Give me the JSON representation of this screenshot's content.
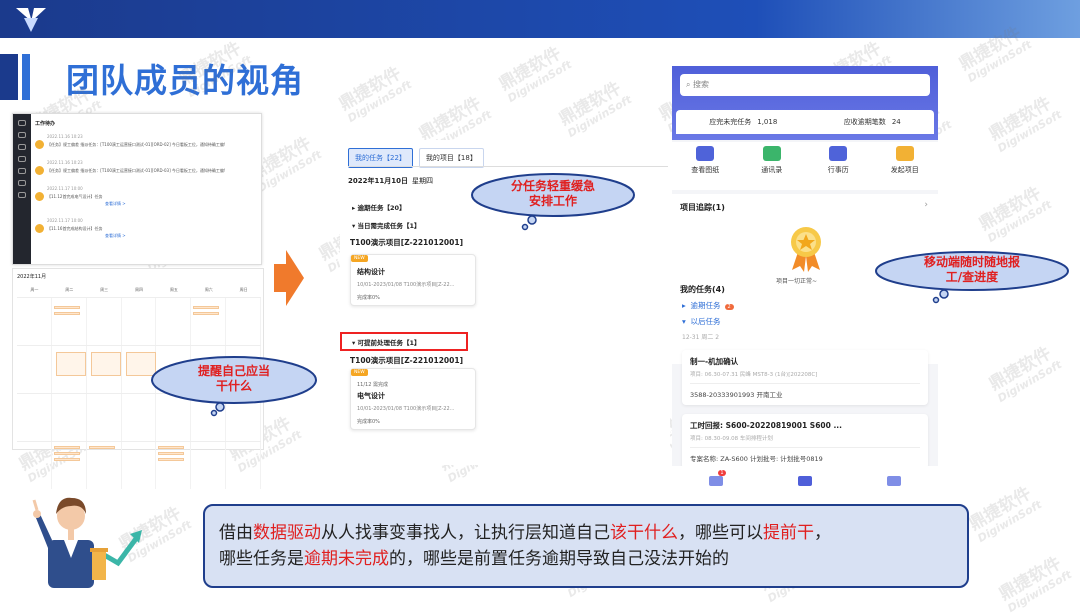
{
  "slide": {
    "title": "团队成员的视角",
    "summary": [
      {
        "text": "借由",
        "hl": false
      },
      {
        "text": "数据驱动",
        "hl": true
      },
      {
        "text": "从人找事变事找人，让执行层知道自己",
        "hl": false
      },
      {
        "text": "该干什么",
        "hl": true
      },
      {
        "text": "，哪些可以",
        "hl": false
      },
      {
        "text": "提前干",
        "hl": true
      },
      {
        "text": "，",
        "hl": false
      },
      {
        "text": "哪些任务是",
        "hl": false
      },
      {
        "text": "逾期未完成",
        "hl": true
      },
      {
        "text": "的，哪些是前置任务逾期导致自己没法开始的",
        "hl": false
      }
    ]
  },
  "watermark": {
    "cn": "鼎捷软件",
    "en": "DigiwinSoft"
  },
  "callouts": {
    "left": "提醒自己应当\n干什么",
    "middle": "分任务轻重缓急\n安排工作",
    "right": "移动端随时随地报\n工/查进度"
  },
  "desktop_feed": {
    "header": "工作待办",
    "items": [
      {
        "time": "2022.11.16 10:23",
        "text": "【任务】规工偏差 指派任务：[T100演工运营接口测试-01][ORD-02]   今日看板工位，通知待确工偏!"
      },
      {
        "time": "2022.11.16 10:23",
        "text": "【任务】规工偏差 指派任务：[T100演工运营接口测试-01][ORD-03]   今日看板工位，通知待确工偏!"
      },
      {
        "time": "2022.11.17 10:00",
        "text": "【11.12首完成电气设计】任务",
        "link": "查看详情 >"
      },
      {
        "time": "2022.11.17 10:00",
        "text": "【11.16首完成结构设计】任务",
        "link": "查看详情 >"
      }
    ]
  },
  "calendar": {
    "title": "2022年11月",
    "days": [
      "周一",
      "周二",
      "周三",
      "周四",
      "周五",
      "周六",
      "周日"
    ]
  },
  "middle": {
    "tabs": [
      {
        "label": "我的任务【22】",
        "active": true
      },
      {
        "label": "我的项目【18】",
        "active": false
      }
    ],
    "date": "2022年11月10日",
    "weekday": "星期四",
    "sections": {
      "overdue": "▸ 逾期任务【20】",
      "today": "▾ 当日需完成任务【1】",
      "advance": "▾ 可提前处理任务【1】"
    },
    "project_title": "T100演示项目[Z-221012001]",
    "badge": "NEW",
    "cards": [
      {
        "prefix": "",
        "title": "结构设计",
        "sub": "10/01-2023/01/08 T100演示项目[Z-22...",
        "rate": "完成率0%"
      },
      {
        "prefix": "11/12 需完成",
        "title": "电气设计",
        "sub": "10/01-2023/01/08 T100演示项目[Z-22...",
        "rate": "完成率0%"
      }
    ]
  },
  "phone": {
    "search_placeholder": "搜索",
    "stats": [
      {
        "label": "应完未完任务",
        "value": "1,018"
      },
      {
        "label": "应收逾期笔数",
        "value": "24"
      }
    ],
    "shortcuts": [
      {
        "label": "查看图纸",
        "icon": "drawing-icon",
        "color": "#4f63d9"
      },
      {
        "label": "通讯录",
        "icon": "contacts-icon",
        "color": "#3bb56b"
      },
      {
        "label": "行事历",
        "icon": "calendar-icon",
        "color": "#4f63d9"
      },
      {
        "label": "发起项目",
        "icon": "project-icon",
        "color": "#f2b134"
      }
    ],
    "tracking_label": "项目追踪(1)",
    "tracking_status": "项目一切正常~",
    "my_tasks": "我的任务(4)",
    "overdue": "逾期任务",
    "overdue_count": "2",
    "later": "以后任务",
    "date": "12-31 周二 2",
    "task_cards": [
      {
        "title": "制一-机加确认",
        "sub": "项目: 06.30-07.31 民峰 MST8-3 (1台)[202208C]",
        "detail": "3588-20333901993 开南工业"
      },
      {
        "title": "工时回报: S600-20220819001 S600 ...",
        "sub": "项目: 08.30-09.08 车间排程计划",
        "detail": "专案名称:  ZA-S600 计划批号:  计划批号0819"
      }
    ],
    "nav": [
      {
        "icon": "message-icon",
        "badge": "1"
      },
      {
        "icon": "home-icon"
      },
      {
        "icon": "apps-icon"
      }
    ]
  }
}
